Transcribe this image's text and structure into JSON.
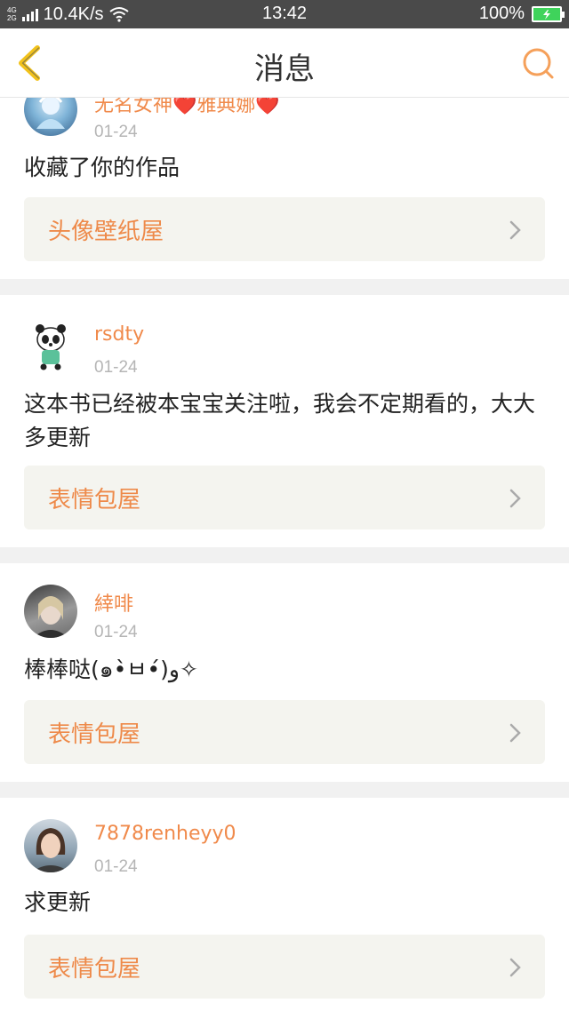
{
  "status": {
    "net_top": "4G",
    "net_bottom": "2G",
    "speed": "10.4K/s",
    "time": "13:42",
    "battery": "100%"
  },
  "header": {
    "title": "消息"
  },
  "messages": [
    {
      "username": "无名女神❤️雅典娜❤️",
      "date": "01-24",
      "text": "收藏了你的作品",
      "ref": "头像壁纸屋"
    },
    {
      "username": "rsdty",
      "date": "01-24",
      "text": "这本书已经被本宝宝关注啦，我会不定期看的，大大多更新",
      "ref": "表情包屋"
    },
    {
      "username": "緈啡",
      "date": "01-24",
      "text": "棒棒哒(๑•̀ㅂ•́)و✧",
      "ref": "表情包屋"
    },
    {
      "username": "7878renheyy0",
      "date": "01-24",
      "text": "求更新",
      "ref": "表情包屋"
    }
  ],
  "colors": {
    "accent": "#f08a4b",
    "back_arrow": "#f2c21b",
    "search": "#f5a05a",
    "ref_bg": "#f4f4ef"
  }
}
